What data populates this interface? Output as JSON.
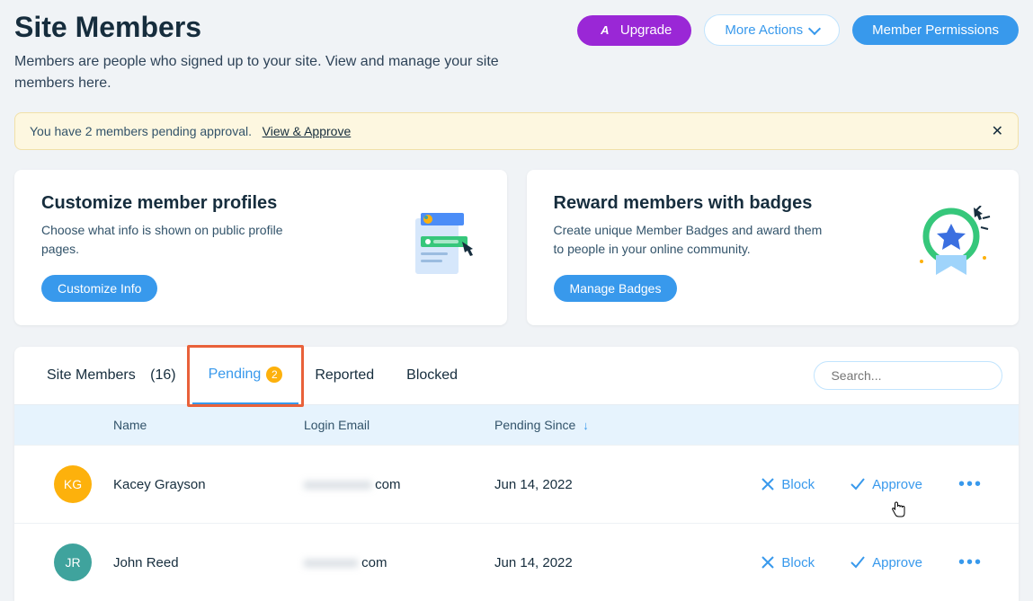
{
  "header": {
    "title": "Site Members",
    "subtitle": "Members are people who signed up to your site. View and manage your site members here.",
    "upgrade_label": "Upgrade",
    "more_actions_label": "More Actions",
    "permissions_label": "Member Permissions"
  },
  "banner": {
    "text": "You have 2 members pending approval.",
    "link_label": "View & Approve"
  },
  "cards": {
    "customize": {
      "title": "Customize member profiles",
      "desc": "Choose what info is shown on public profile pages.",
      "cta": "Customize Info"
    },
    "badges": {
      "title": "Reward members with badges",
      "desc": "Create unique Member Badges and award them to people in your online community.",
      "cta": "Manage Badges"
    }
  },
  "tabs": {
    "members": {
      "label": "Site Members",
      "count": "(16)"
    },
    "pending": {
      "label": "Pending",
      "badge": "2"
    },
    "reported": {
      "label": "Reported"
    },
    "blocked": {
      "label": "Blocked"
    }
  },
  "search": {
    "placeholder": "Search..."
  },
  "columns": {
    "name": "Name",
    "email": "Login Email",
    "pending_since": "Pending Since"
  },
  "rows": [
    {
      "initials": "KG",
      "avatar_color": "#fdb10c",
      "name": "Kacey Grayson",
      "email_hidden": "xxxxxxxxxx",
      "email_suffix": "com",
      "pending_since": "Jun 14, 2022"
    },
    {
      "initials": "JR",
      "avatar_color": "#3fa39d",
      "name": "John Reed",
      "email_hidden": "xxxxxxxx",
      "email_suffix": "com",
      "pending_since": "Jun 14, 2022"
    }
  ],
  "actions": {
    "block": "Block",
    "approve": "Approve"
  }
}
